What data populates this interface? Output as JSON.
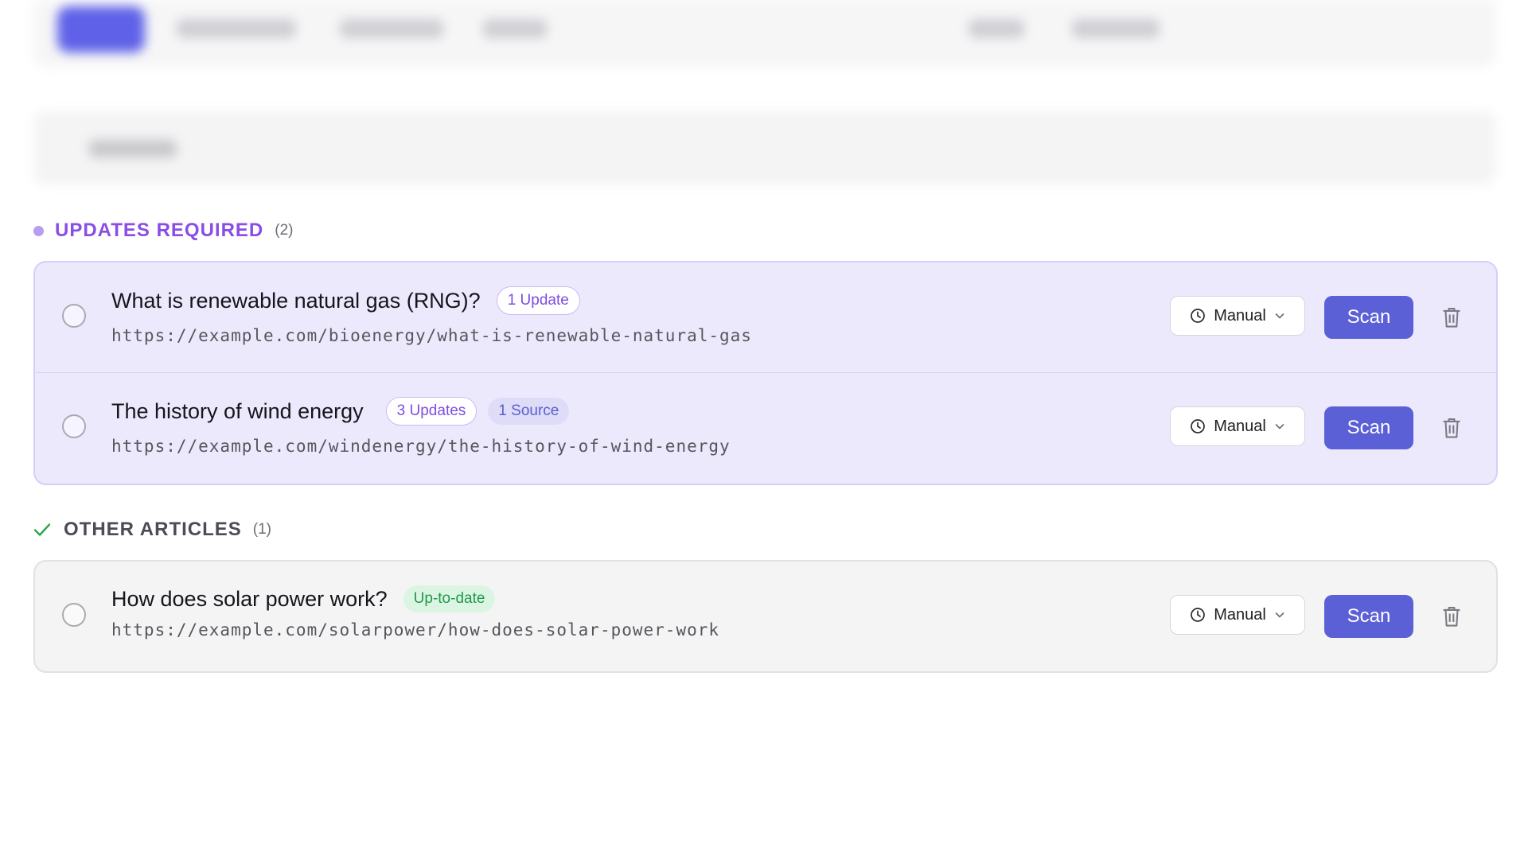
{
  "sections": {
    "updates_required": {
      "label": "UPDATES REQUIRED",
      "count": "(2)",
      "dot_color": "#b79cf0",
      "title_color": "#8a4de6"
    },
    "other_articles": {
      "label": "OTHER ARTICLES",
      "count": "(1)",
      "check_color": "#2aa84a"
    }
  },
  "articles": [
    {
      "title": "What is renewable natural gas (RNG)?",
      "badges": [
        "1 Update"
      ],
      "url": "https://example.com/bioenergy/what-is-renewable-natural-gas",
      "schedule": "Manual",
      "scan_label": "Scan"
    },
    {
      "title": "The history of wind energy",
      "badges": [
        "3 Updates",
        "1 Source"
      ],
      "url": "https://example.com/windenergy/the-history-of-wind-energy",
      "schedule": "Manual",
      "scan_label": "Scan"
    },
    {
      "title": "How does solar power work?",
      "badges": [
        "Up-to-date"
      ],
      "url": "https://example.com/solarpower/how-does-solar-power-work",
      "schedule": "Manual",
      "scan_label": "Scan"
    }
  ],
  "colors": {
    "accent": "#5b60d6",
    "purple_bg": "#ede9fd",
    "gray_bg": "#f4f4f5",
    "ok_green": "#1f9a4b"
  },
  "icons": [
    "clock-icon",
    "chevron-down-icon",
    "trash-icon",
    "check-icon"
  ]
}
